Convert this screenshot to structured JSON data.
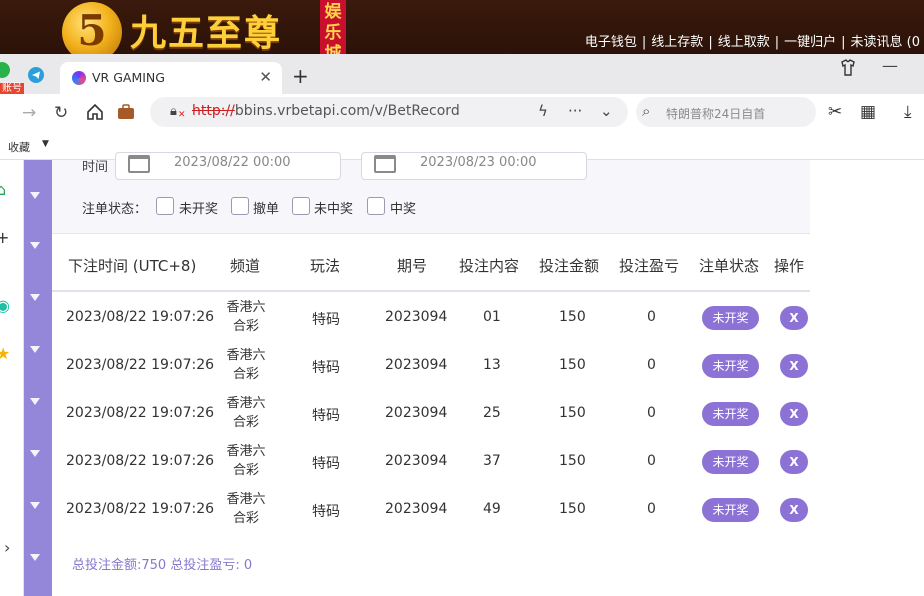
{
  "banner": {
    "logo_glyph": "5",
    "brand_title": "九五至尊",
    "brand_tag": "娱乐城",
    "links": [
      "电子钱包",
      "线上存款",
      "线上取款",
      "一键归户",
      "未读讯息 (0"
    ],
    "separator": "|"
  },
  "browser": {
    "badge_text": "账号",
    "tab_title": "VR GAMING",
    "url_protocol": "http://",
    "url_rest": "bbins.vrbetapi.com/v/BetRecord",
    "search_placeholder": "特朗普称24日自首",
    "bookmarks_label": "收藏"
  },
  "filter": {
    "time_label": "时间",
    "date_start": "2023/08/22 00:00",
    "date_end": "2023/08/23 00:00",
    "status_label": "注单状态：",
    "status_options": [
      "未开奖",
      "撤单",
      "未中奖",
      "中奖"
    ]
  },
  "table": {
    "headers": [
      "下注时间 (UTC+8)",
      "频道",
      "玩法",
      "期号",
      "投注内容",
      "投注金额",
      "投注盈亏",
      "注单状态",
      "操作"
    ],
    "rows": [
      {
        "time": "2023/08/22 19:07:26",
        "channel_1": "香港六",
        "channel_2": "合彩",
        "play": "特码",
        "period": "2023094",
        "content": "01",
        "amount": "150",
        "profit": "0",
        "status": "未开奖",
        "action": "X"
      },
      {
        "time": "2023/08/22 19:07:26",
        "channel_1": "香港六",
        "channel_2": "合彩",
        "play": "特码",
        "period": "2023094",
        "content": "13",
        "amount": "150",
        "profit": "0",
        "status": "未开奖",
        "action": "X"
      },
      {
        "time": "2023/08/22 19:07:26",
        "channel_1": "香港六",
        "channel_2": "合彩",
        "play": "特码",
        "period": "2023094",
        "content": "25",
        "amount": "150",
        "profit": "0",
        "status": "未开奖",
        "action": "X"
      },
      {
        "time": "2023/08/22 19:07:26",
        "channel_1": "香港六",
        "channel_2": "合彩",
        "play": "特码",
        "period": "2023094",
        "content": "37",
        "amount": "150",
        "profit": "0",
        "status": "未开奖",
        "action": "X"
      },
      {
        "time": "2023/08/22 19:07:26",
        "channel_1": "香港六",
        "channel_2": "合彩",
        "play": "特码",
        "period": "2023094",
        "content": "49",
        "amount": "150",
        "profit": "0",
        "status": "未开奖",
        "action": "X"
      }
    ]
  },
  "summary": {
    "text": "总投注金额:750 总投注盈亏: 0"
  },
  "colors": {
    "accent_purple": "#8d72d6",
    "strip_purple": "#9486d9",
    "banner_brown": "#3a1a0c",
    "gold": "#ffcf3a"
  }
}
